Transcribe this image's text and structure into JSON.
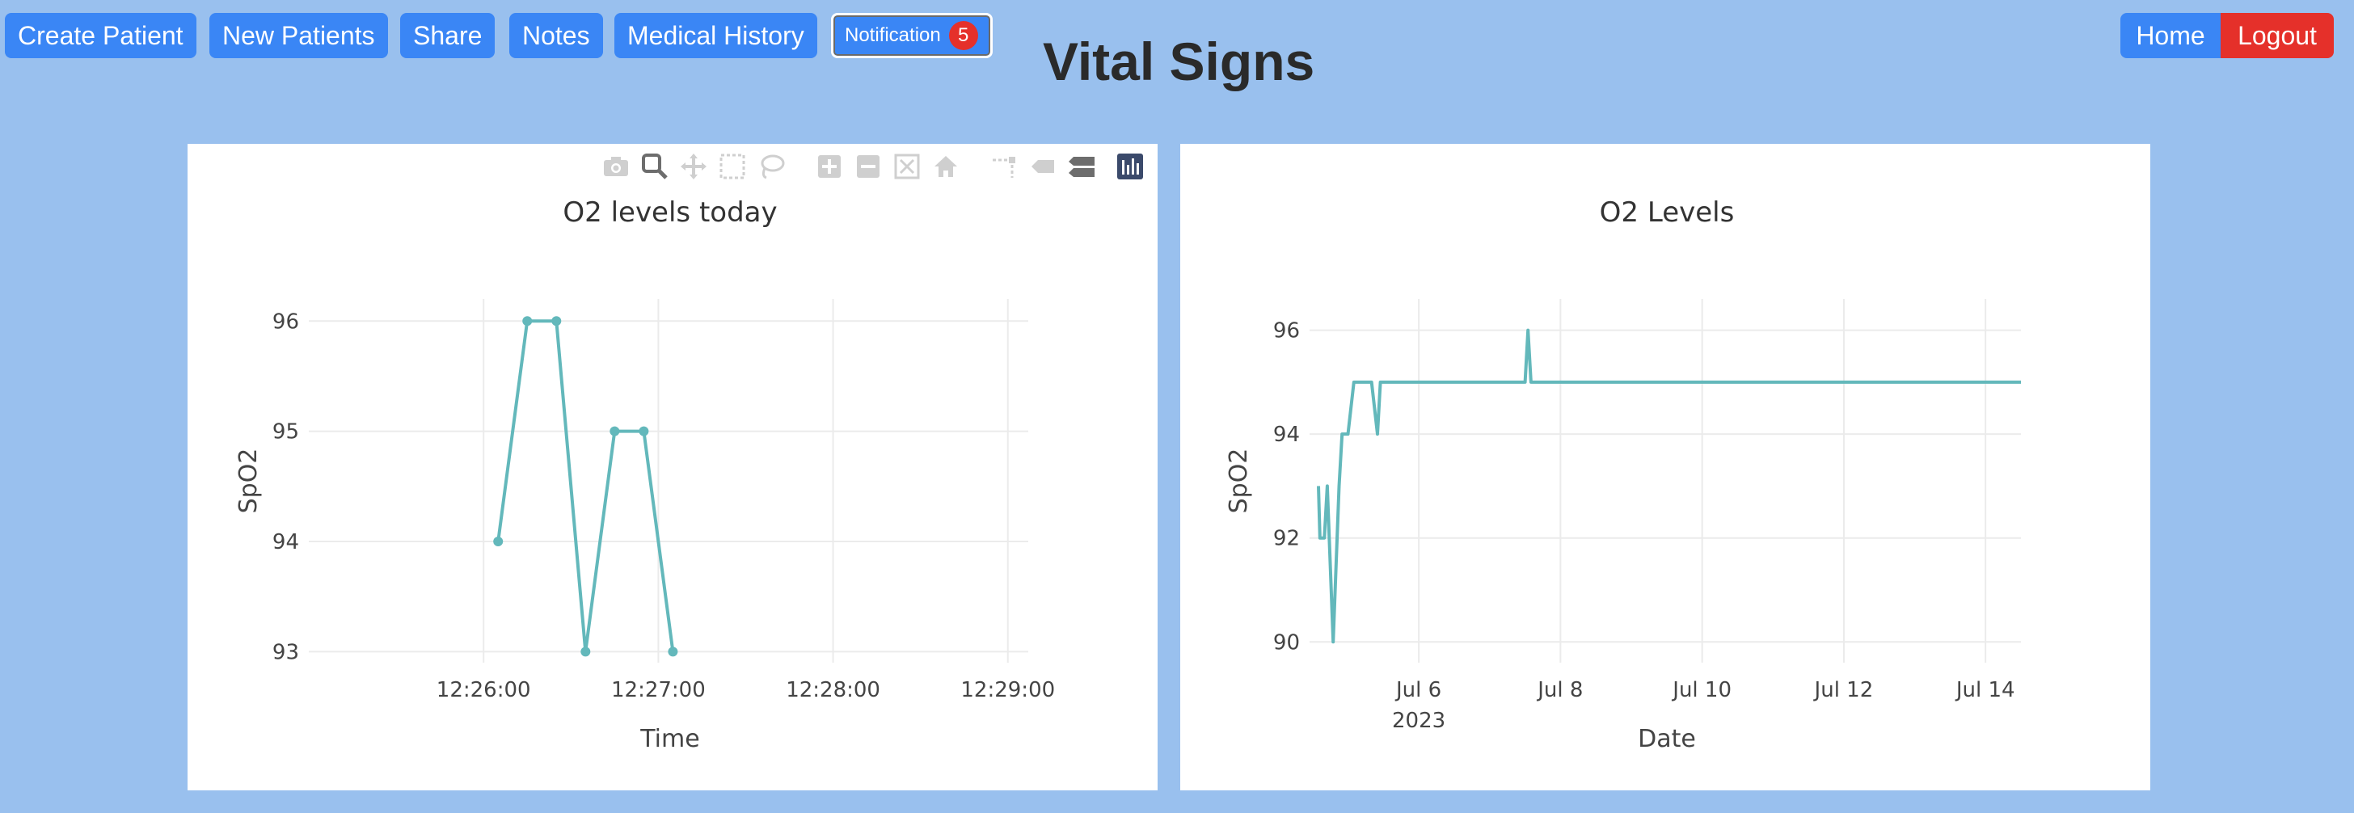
{
  "nav": {
    "create_patient": "Create Patient",
    "new_patients": "New Patients",
    "share": "Share",
    "notes": "Notes",
    "medical_history": "Medical History",
    "notification_label": "Notification",
    "notification_count": "5",
    "home": "Home",
    "logout": "Logout"
  },
  "page": {
    "title": "Vital Signs"
  },
  "modebar_icons": [
    "camera-icon",
    "zoom-icon",
    "pan-icon",
    "box-select-icon",
    "lasso-icon",
    "zoom-in-icon",
    "zoom-out-icon",
    "autoscale-icon",
    "reset-axes-icon",
    "spike-lines-icon",
    "hover-closest-icon",
    "hover-compare-icon",
    "plotly-logo-icon"
  ],
  "colors": {
    "background": "#99c0ee",
    "button": "#3a86f5",
    "logout": "#e5302a",
    "badge": "#e5302a",
    "line": "#63b8bb"
  },
  "chart_data": [
    {
      "type": "line",
      "title": "O2 levels today",
      "xlabel": "Time",
      "ylabel": "SpO2",
      "markers": true,
      "x": [
        "12:26:05",
        "12:26:15",
        "12:26:25",
        "12:26:35",
        "12:26:45",
        "12:26:55",
        "12:27:05"
      ],
      "y": [
        94,
        96,
        96,
        93,
        95,
        95,
        93
      ],
      "xlim": [
        "12:25:00",
        "12:29:07"
      ],
      "ylim": [
        92.9,
        96.2
      ],
      "xticks": [
        "12:26:00",
        "12:27:00",
        "12:28:00",
        "12:29:00"
      ],
      "yticks": [
        "93",
        "94",
        "95",
        "96"
      ],
      "grid": true
    },
    {
      "type": "line",
      "title": "O2 Levels",
      "xlabel": "Date",
      "ylabel": "SpO2",
      "markers": false,
      "x": [
        "2023-07-04 14:00",
        "2023-07-04 14:30",
        "2023-07-04 16:00",
        "2023-07-04 17:00",
        "2023-07-04 19:00",
        "2023-07-04 21:00",
        "2023-07-04 22:00",
        "2023-07-05 00:00",
        "2023-07-05 02:00",
        "2023-07-05 08:00",
        "2023-07-05 10:00",
        "2023-07-05 11:00",
        "2023-07-07 12:00",
        "2023-07-07 13:00",
        "2023-07-07 14:00",
        "2023-07-14 12:00"
      ],
      "y": [
        93,
        92,
        92,
        93,
        90,
        93,
        94,
        94,
        95,
        95,
        94,
        95,
        95,
        96,
        95,
        95
      ],
      "xlim": [
        "2023-07-04 11:00",
        "2023-07-14 12:00"
      ],
      "ylim": [
        89.6,
        96.6
      ],
      "xticks": [
        "Jul 6",
        "Jul 8",
        "Jul 10",
        "Jul 12",
        "Jul 14"
      ],
      "xtick_subtitle": "2023",
      "yticks": [
        "90",
        "92",
        "94",
        "96"
      ],
      "grid": true
    }
  ]
}
